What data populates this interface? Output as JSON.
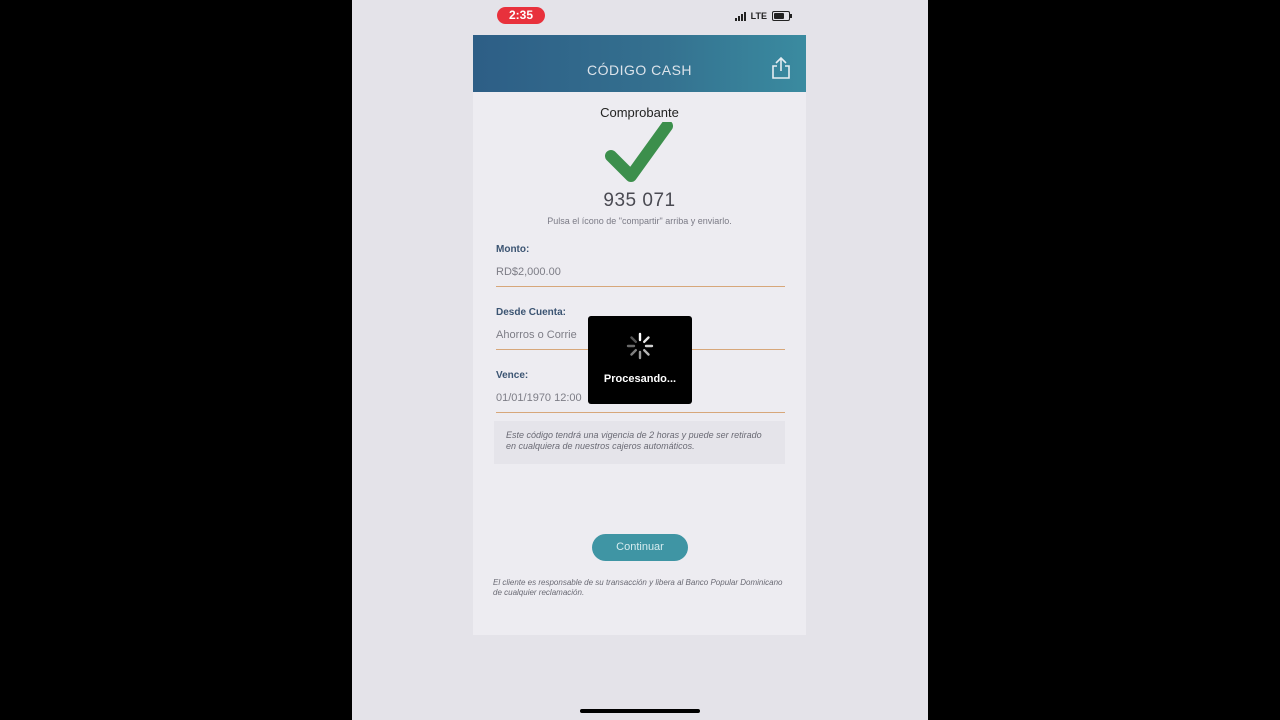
{
  "status_bar": {
    "time": "2:35",
    "network": "LTE"
  },
  "header": {
    "title": "CÓDIGO CASH",
    "share_icon": "share-icon"
  },
  "receipt": {
    "title": "Comprobante",
    "code": "935 071",
    "hint": "Pulsa el ícono de \"compartir\" arriba y enviarlo."
  },
  "fields": [
    {
      "label": "Monto:",
      "value": "RD$2,000.00"
    },
    {
      "label": "Desde Cuenta:",
      "value": "Ahorros o Corrie"
    },
    {
      "label": "Vence:",
      "value": "01/01/1970 12:00"
    }
  ],
  "notice": "Este código tendrá una vigencia de 2 horas y puede ser retirado en cualquiera de nuestros cajeros automáticos.",
  "continue_label": "Continuar",
  "disclaimer": "El cliente es responsable de su transacción y libera al Banco Popular Dominicano de cualquier reclamación.",
  "overlay": {
    "text": "Procesando..."
  },
  "colors": {
    "accent": "#3f95a4",
    "check": "#3c8f4c",
    "header": "#2d5e86",
    "badge": "#e8313c"
  }
}
